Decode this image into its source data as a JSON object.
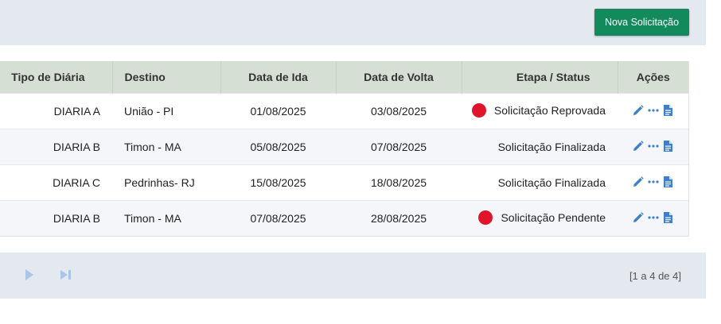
{
  "toolbar": {
    "new_label": "Nova Solicitação"
  },
  "table": {
    "headers": [
      "Tipo de Diária",
      "Destino",
      "Data de Ida",
      "Data de Volta",
      "Etapa / Status",
      "Ações"
    ],
    "rows": [
      {
        "tipo": "DIARIA A",
        "destino": "União - PI",
        "ida": "01/08/2025",
        "volta": "03/08/2025",
        "status": "Solicitação Reprovada",
        "indicator": true
      },
      {
        "tipo": "DIARIA B",
        "destino": "Timon - MA",
        "ida": "05/08/2025",
        "volta": "07/08/2025",
        "status": "Solicitação Finalizada",
        "indicator": false
      },
      {
        "tipo": "DIARIA C",
        "destino": "Pedrinhas- RJ",
        "ida": "15/08/2025",
        "volta": "18/08/2025",
        "status": "Solicitação Finalizada",
        "indicator": false
      },
      {
        "tipo": "DIARIA B",
        "destino": "Timon - MA",
        "ida": "07/08/2025",
        "volta": "28/08/2025",
        "status": "Solicitação Pendente",
        "indicator": true
      }
    ]
  },
  "pagination": {
    "info": "[1 a 4 de 4]"
  },
  "icons": {
    "edit": "pencil-icon",
    "more": "more-horizontal-icon",
    "document": "document-icon",
    "next": "next-page-icon",
    "last": "last-page-icon"
  },
  "colors": {
    "primary_button": "#128a5c",
    "header_bg": "#d6dfd4",
    "status_dot": "#e0142b",
    "action_icon": "#3f7fc9"
  }
}
